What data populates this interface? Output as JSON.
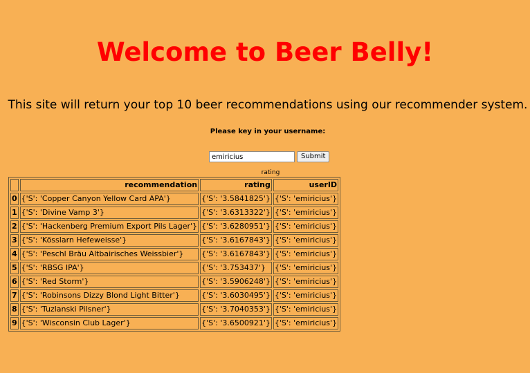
{
  "page": {
    "title": "Welcome to Beer Belly!",
    "subtitle": "This site will return your top 10 beer recommendations using our recommender system.",
    "prompt": "Please key in your username:"
  },
  "form": {
    "username_value": "emiricius",
    "submit_label": "Submit"
  },
  "table": {
    "caption": "rating",
    "columns": [
      "recommendation",
      "rating",
      "userID"
    ],
    "rows": [
      {
        "index": "0",
        "recommendation": "{'S': 'Copper Canyon Yellow Card APA'}",
        "rating": "{'S': '3.5841825'}",
        "userID": "{'S': 'emiricius'}"
      },
      {
        "index": "1",
        "recommendation": "{'S': 'Divine Vamp 3'}",
        "rating": "{'S': '3.6313322'}",
        "userID": "{'S': 'emiricius'}"
      },
      {
        "index": "2",
        "recommendation": "{'S': 'Hackenberg Premium Export Pils Lager'}",
        "rating": "{'S': '3.6280951'}",
        "userID": "{'S': 'emiricius'}"
      },
      {
        "index": "3",
        "recommendation": "{'S': 'Kösslarn Hefeweisse'}",
        "rating": "{'S': '3.6167843'}",
        "userID": "{'S': 'emiricius'}"
      },
      {
        "index": "4",
        "recommendation": "{'S': 'Peschl Bräu Altbairisches Weissbier'}",
        "rating": "{'S': '3.6167843'}",
        "userID": "{'S': 'emiricius'}"
      },
      {
        "index": "5",
        "recommendation": "{'S': 'RBSG IPA'}",
        "rating": "{'S': '3.753437'}",
        "userID": "{'S': 'emiricius'}"
      },
      {
        "index": "6",
        "recommendation": "{'S': 'Red Storm'}",
        "rating": "{'S': '3.5906248'}",
        "userID": "{'S': 'emiricius'}"
      },
      {
        "index": "7",
        "recommendation": "{'S': 'Robinsons Dizzy Blond Light Bitter'}",
        "rating": "{'S': '3.6030495'}",
        "userID": "{'S': 'emiricius'}"
      },
      {
        "index": "8",
        "recommendation": "{'S': 'Tuzlanski Pilsner'}",
        "rating": "{'S': '3.7040353'}",
        "userID": "{'S': 'emiricius'}"
      },
      {
        "index": "9",
        "recommendation": "{'S': 'Wisconsin Club Lager'}",
        "rating": "{'S': '3.6500921'}",
        "userID": "{'S': 'emiricius'}"
      }
    ]
  },
  "colors": {
    "background": "#f8b054",
    "title": "#ff0000"
  }
}
